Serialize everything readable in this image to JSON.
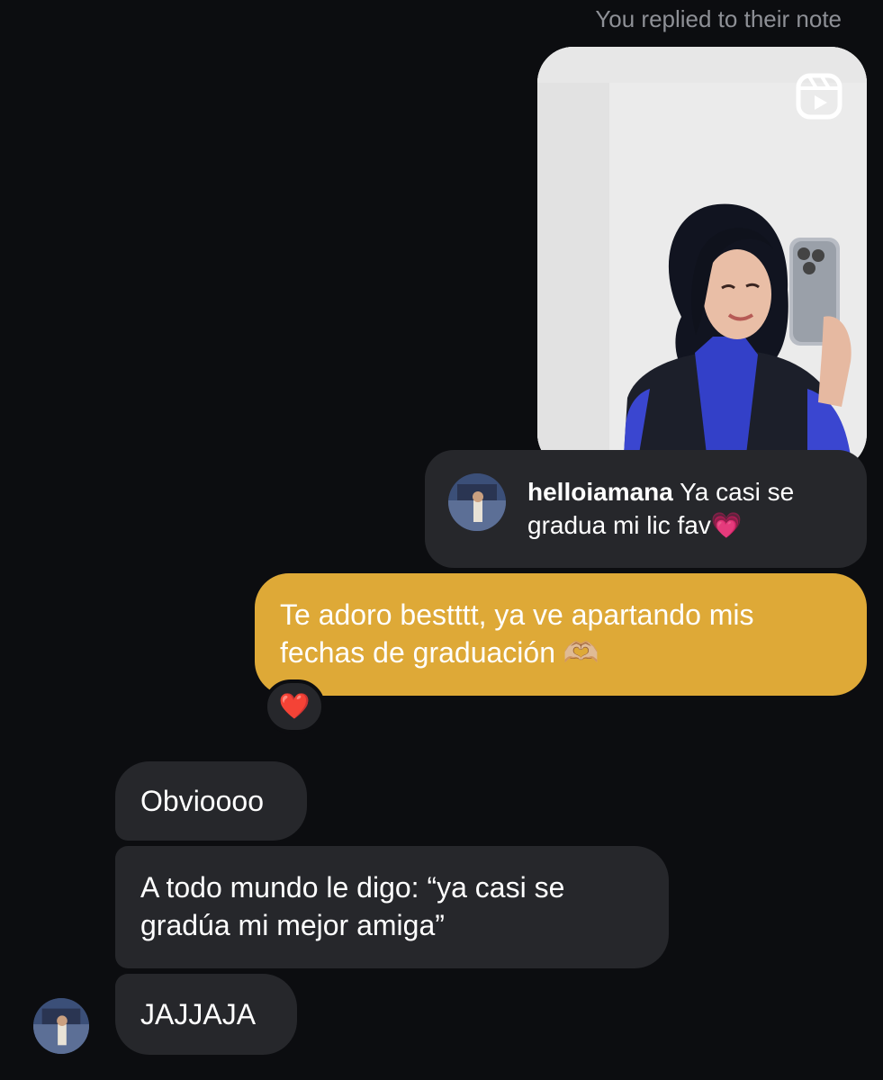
{
  "header": {
    "replied_label": "You replied to their note"
  },
  "reel": {
    "icon": "reels-icon"
  },
  "note": {
    "username": "helloiamana",
    "text": "Ya casi se gradua mi lic fav💗",
    "avatar_icon": "avatar"
  },
  "sent_message": {
    "text": "Te adoro bestttt, ya ve apartando mis fechas de graduación 🫶🏼",
    "reaction": "❤️"
  },
  "received_messages": [
    {
      "text": "Obvioooo"
    },
    {
      "text": "A todo mundo le digo: “ya casi se gradúa mi mejor amiga”"
    },
    {
      "text": "JAJJAJA"
    }
  ],
  "colors": {
    "background": "#0c0d10",
    "received_bubble": "#26272b",
    "sent_bubble": "#dea937",
    "muted_text": "#8e9096"
  }
}
